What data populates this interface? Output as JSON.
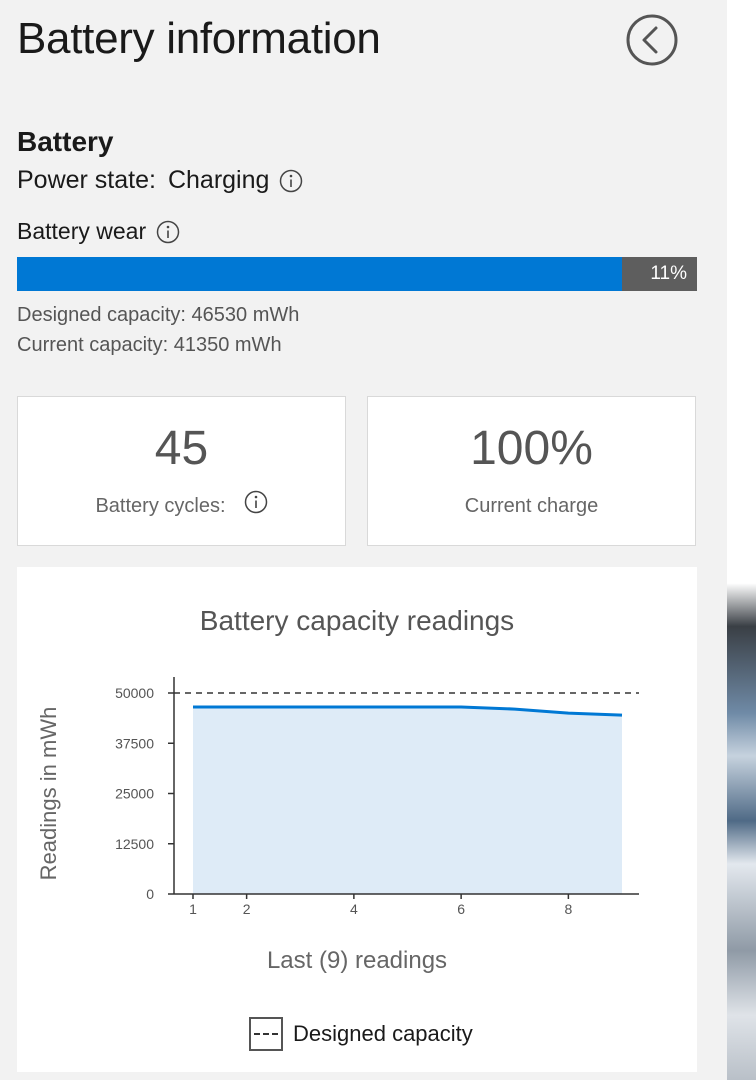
{
  "header": {
    "title": "Battery information"
  },
  "battery": {
    "section_title": "Battery",
    "power_state_label": "Power state:",
    "power_state_value": "Charging",
    "wear_label": "Battery wear",
    "wear_percent_text": "11%",
    "wear_fraction": 0.11,
    "designed_capacity_text": "Designed capacity:  46530  mWh",
    "current_capacity_text": "Current capacity:  41350  mWh"
  },
  "cards": {
    "cycles_value": "45",
    "cycles_label": "Battery cycles:",
    "charge_value": "100%",
    "charge_label": "Current charge"
  },
  "colors": {
    "accent": "#0078d4",
    "bar_bg": "#5e5e5e",
    "area_fill": "#deebf7"
  },
  "chart_data": {
    "type": "area",
    "title": "Battery capacity readings",
    "xlabel": "Last (9) readings",
    "ylabel": "Readings in mWh",
    "x": [
      1,
      2,
      3,
      4,
      5,
      6,
      7,
      8,
      9
    ],
    "x_tick_labels": [
      "1",
      "2",
      "4",
      "6",
      "8"
    ],
    "x_tick_values": [
      1,
      2,
      4,
      6,
      8
    ],
    "y_ticks": [
      0,
      12500,
      25000,
      37500,
      50000
    ],
    "ylim": [
      0,
      50000
    ],
    "series": [
      {
        "values": [
          46530,
          46530,
          46530,
          46530,
          46530,
          46530,
          46000,
          45000,
          44500
        ]
      }
    ],
    "reference_line": {
      "name": "Designed capacity",
      "value": 50000
    },
    "legend": "bottom",
    "grid": false
  }
}
